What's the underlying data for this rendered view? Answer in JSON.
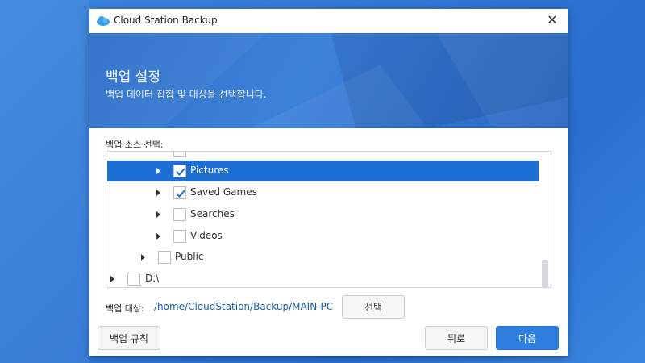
{
  "window": {
    "title": "Cloud Station Backup",
    "close_glyph": "✕"
  },
  "banner": {
    "title": "백업 설정",
    "subtitle": "백업 데이터 집합 및 대상을 선택합니다."
  },
  "source": {
    "label": "백업 소스 선택:",
    "items": [
      {
        "label": "Pictures",
        "checked": true,
        "selected": true
      },
      {
        "label": "Saved Games",
        "checked": true,
        "selected": false
      },
      {
        "label": "Searches",
        "checked": false,
        "selected": false
      },
      {
        "label": "Videos",
        "checked": false,
        "selected": false
      },
      {
        "label": "Public",
        "checked": false,
        "selected": false
      },
      {
        "label": "D:\\",
        "checked": false,
        "selected": false
      }
    ]
  },
  "destination": {
    "label": "백업 대상:",
    "path": "/home/CloudStation/Backup/MAIN-PC",
    "select_label": "선택"
  },
  "footer": {
    "rules_label": "백업 규칙",
    "back_label": "뒤로",
    "next_label": "다음"
  },
  "colors": {
    "accent": "#1e6fd4",
    "primary_button": "#2f7fe0",
    "path_text": "#1a5fa8"
  }
}
